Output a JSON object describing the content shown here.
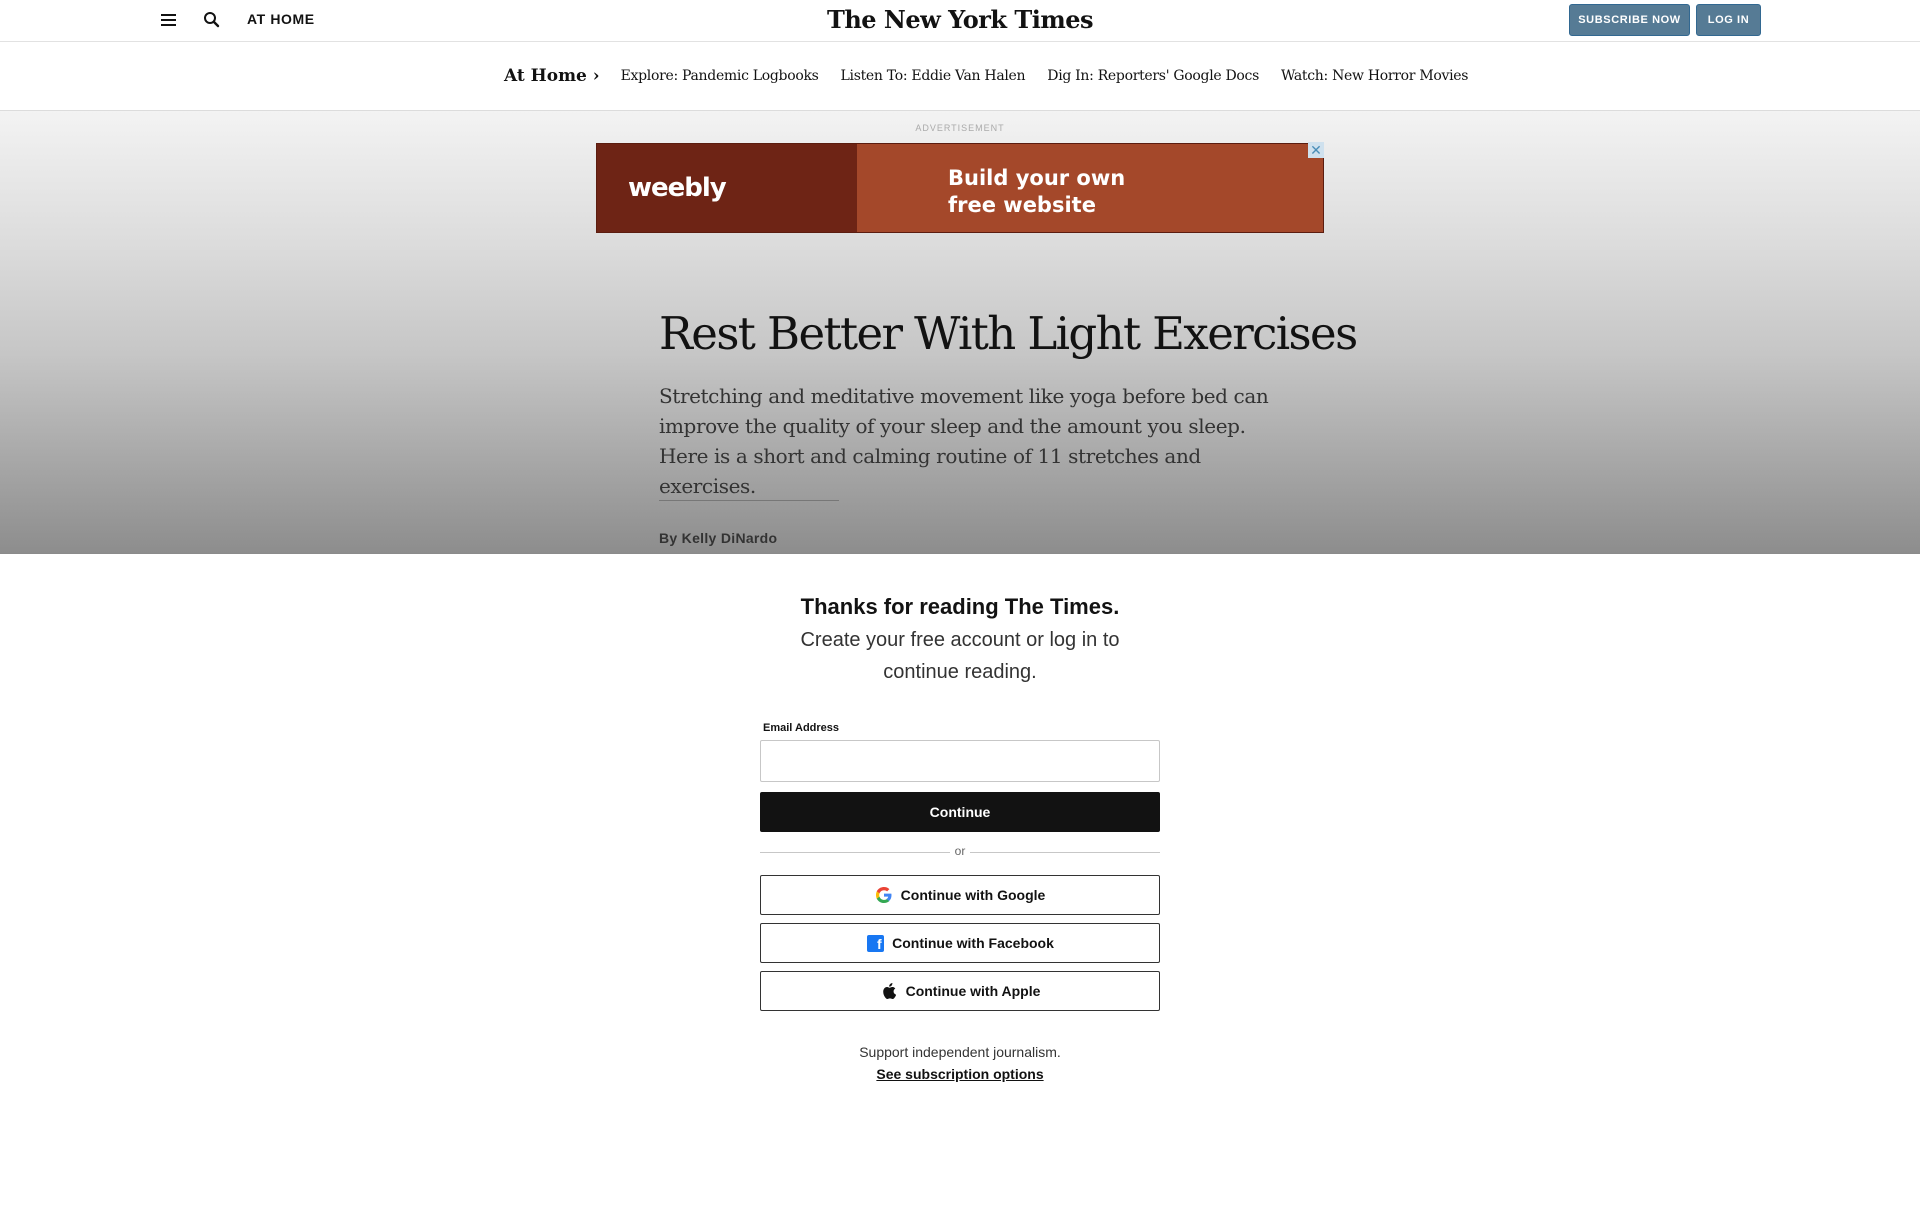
{
  "header": {
    "section_label": "AT HOME",
    "logo_text": "The New York Times",
    "subscribe_label": "SUBSCRIBE NOW",
    "login_label": "LOG IN"
  },
  "subnav": {
    "home_label": "At Home ›",
    "links": [
      "Explore: Pandemic Logbooks",
      "Listen To: Eddie Van Halen",
      "Dig In: Reporters' Google Docs",
      "Watch: New Horror Movies"
    ]
  },
  "ad": {
    "label": "ADVERTISEMENT",
    "brand": "weebly",
    "line1": "Build your own",
    "line2": "free website",
    "close": "✕"
  },
  "article": {
    "headline": "Rest Better With Light Exercises",
    "summary": "Stretching and meditative movement like yoga before bed can improve the quality of your sleep and the amount you sleep. Here is a short and calming routine of 11 stretches and exercises.",
    "byline": "By Kelly DiNardo"
  },
  "paywall": {
    "title": "Thanks for reading The Times.",
    "subtitle": "Create your free account or log in to continue reading.",
    "email_label": "Email Address",
    "email_value": "",
    "continue_label": "Continue",
    "or_label": "or",
    "google_label": "Continue with Google",
    "facebook_label": "Continue with Facebook",
    "apple_label": "Continue with Apple",
    "support_text": "Support independent journalism.",
    "subscription_link": "See subscription options"
  },
  "colors": {
    "subscribe_bg": "#567b95",
    "ad_left": "#6e2415",
    "ad_right": "#a4482a"
  }
}
